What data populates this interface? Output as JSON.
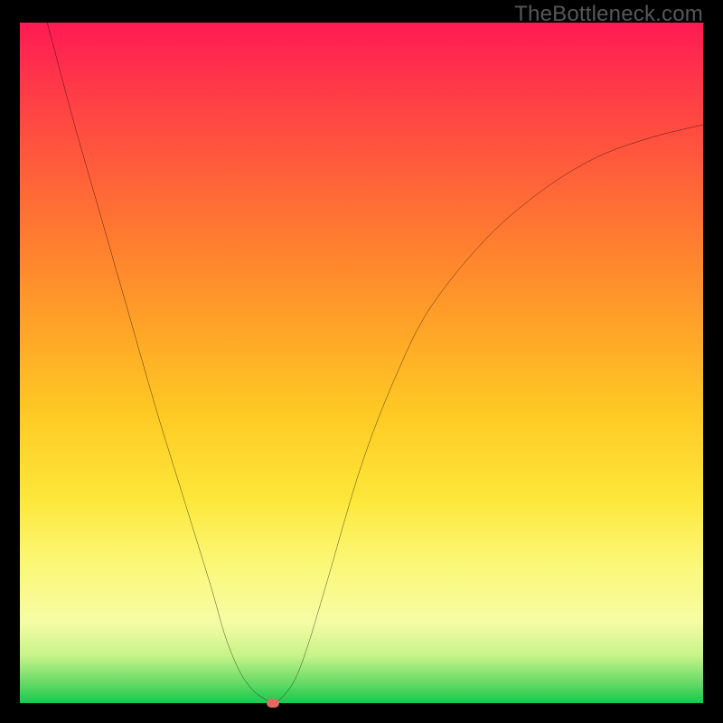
{
  "watermark": "TheBottleneck.com",
  "chart_data": {
    "type": "line",
    "title": "",
    "xlabel": "",
    "ylabel": "",
    "xlim": [
      0,
      100
    ],
    "ylim": [
      0,
      100
    ],
    "grid": false,
    "series": [
      {
        "name": "curve",
        "x": [
          4,
          8,
          12,
          16,
          20,
          24,
          28,
          30,
          32,
          34,
          36,
          37,
          38,
          40,
          42,
          45,
          50,
          55,
          60,
          68,
          76,
          84,
          92,
          100
        ],
        "y": [
          100,
          85,
          71,
          57,
          43,
          30,
          17,
          10,
          5,
          2,
          0.5,
          0,
          0.5,
          3,
          8,
          18,
          35,
          48,
          58,
          68,
          75,
          80,
          83,
          85
        ]
      }
    ],
    "marker": {
      "x": 37,
      "y": 0,
      "color": "#e06a63"
    },
    "background_gradient": {
      "stops": [
        {
          "pos": 0,
          "color": "#ff1a54"
        },
        {
          "pos": 25,
          "color": "#ff6a36"
        },
        {
          "pos": 50,
          "color": "#feb825"
        },
        {
          "pos": 75,
          "color": "#fbf062"
        },
        {
          "pos": 100,
          "color": "#17c94e"
        }
      ]
    }
  }
}
